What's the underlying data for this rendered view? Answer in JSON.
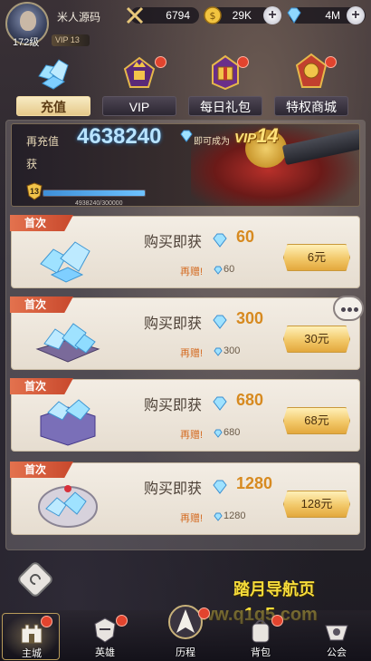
{
  "player": {
    "name": "米人源码",
    "level_badge": "172级",
    "vip_tag": "VIP 13"
  },
  "resources": [
    {
      "icon": "swords-icon",
      "value": "6794"
    },
    {
      "icon": "gold-coin-icon",
      "value": "29K"
    },
    {
      "icon": "diamond-icon",
      "value": "4M"
    }
  ],
  "tabs": [
    {
      "label": "充值",
      "icon": "diamond-pile-icon",
      "active": true
    },
    {
      "label": "VIP",
      "icon": "vip-crown-emblem-icon",
      "active": false
    },
    {
      "label": "每日礼包",
      "icon": "daily-gift-emblem-icon",
      "active": false
    },
    {
      "label": "特权商城",
      "icon": "privilege-shop-emblem-icon",
      "active": false
    }
  ],
  "banner": {
    "recharge_prefix": "再充值",
    "recharge_amount": "4638240",
    "become_text": "即可成为",
    "vip_target": "VIP",
    "vip_target_level": "14",
    "gain_text": "获",
    "current_vip": "13",
    "progress_text": "4938240/300000"
  },
  "offers": [
    {
      "ribbon": "首次",
      "buy_label": "购买即获",
      "amount": "60",
      "bonus_label": "再赠!",
      "bonus_amount": "60",
      "price": "6元"
    },
    {
      "ribbon": "首次",
      "buy_label": "购买即获",
      "amount": "300",
      "bonus_label": "再赠!",
      "bonus_amount": "300",
      "price": "30元"
    },
    {
      "ribbon": "首次",
      "buy_label": "购买即获",
      "amount": "680",
      "bonus_label": "再赠!",
      "bonus_amount": "680",
      "price": "68元"
    },
    {
      "ribbon": "首次",
      "buy_label": "购买即获",
      "amount": "1280",
      "bonus_label": "再赠!",
      "bonus_amount": "1280",
      "price": "128元"
    }
  ],
  "watermark": {
    "line1": "踏月导航页",
    "line2": "www.q1q5.com"
  },
  "nav": [
    {
      "label": "主城",
      "icon": "castle-icon"
    },
    {
      "label": "英雄",
      "icon": "hero-helmet-icon"
    },
    {
      "label": "历程",
      "icon": "journey-emblem-icon"
    },
    {
      "label": "背包",
      "icon": "backpack-icon"
    },
    {
      "label": "公会",
      "icon": "guild-icon"
    }
  ],
  "colors": {
    "accent_gold": "#e6c98a",
    "price_gold": "#f2c869",
    "ribbon_red": "#c8482c",
    "amount_orange": "#d78a20",
    "notification_red": "#e2442e"
  }
}
